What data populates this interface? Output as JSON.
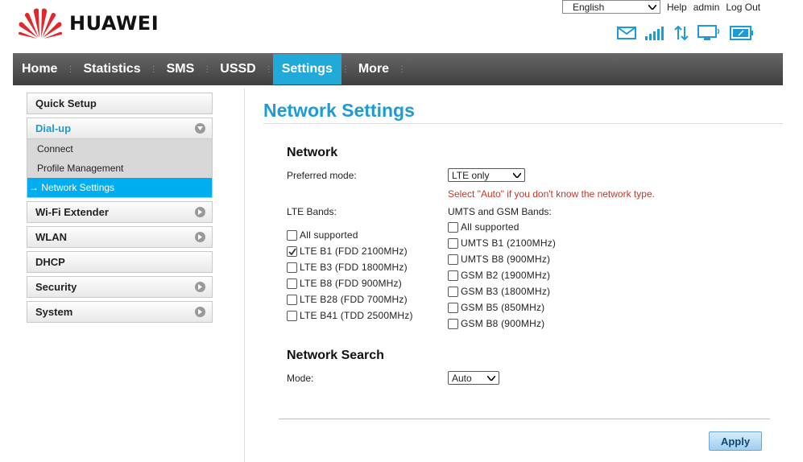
{
  "brand": {
    "name": "HUAWEI"
  },
  "top": {
    "language": "English",
    "help": "Help",
    "user": "admin",
    "logout": "Log Out"
  },
  "status_icons": [
    "mail-icon",
    "signal-strength-icon",
    "data-transfer-icon",
    "pc-connected-icon",
    "battery-icon"
  ],
  "nav": [
    {
      "label": "Home",
      "active": false
    },
    {
      "label": "Statistics",
      "active": false
    },
    {
      "label": "SMS",
      "active": false
    },
    {
      "label": "USSD",
      "active": false
    },
    {
      "label": "Settings",
      "active": true
    },
    {
      "label": "More",
      "active": false
    }
  ],
  "sidebar": {
    "quick_setup": "Quick Setup",
    "dialup": "Dial-up",
    "dialup_sub": [
      "Connect",
      "Profile Management",
      "→ Network Settings"
    ],
    "wifi_extender": "Wi-Fi Extender",
    "wlan": "WLAN",
    "dhcp": "DHCP",
    "security": "Security",
    "system": "System"
  },
  "page": {
    "title": "Network Settings"
  },
  "network": {
    "heading": "Network",
    "preferred_label": "Preferred mode:",
    "preferred_value": "LTE only",
    "hint": "Select \"Auto\" if you don't know the network type.",
    "lte_label": "LTE Bands:",
    "umts_label": "UMTS and GSM Bands:",
    "lte_bands": [
      {
        "label": "All supported",
        "checked": false
      },
      {
        "label": "LTE B1 (FDD 2100MHz)",
        "checked": true
      },
      {
        "label": "LTE B3 (FDD 1800MHz)",
        "checked": false
      },
      {
        "label": "LTE B8 (FDD 900MHz)",
        "checked": false
      },
      {
        "label": "LTE B28 (FDD 700MHz)",
        "checked": false
      },
      {
        "label": "LTE B41 (TDD 2500MHz)",
        "checked": false
      }
    ],
    "umts_bands": [
      {
        "label": "All supported",
        "checked": false
      },
      {
        "label": "UMTS B1 (2100MHz)",
        "checked": false
      },
      {
        "label": "UMTS B8 (900MHz)",
        "checked": false
      },
      {
        "label": "GSM B2 (1900MHz)",
        "checked": false
      },
      {
        "label": "GSM B3 (1800MHz)",
        "checked": false
      },
      {
        "label": "GSM B5 (850MHz)",
        "checked": false
      },
      {
        "label": "GSM B8 (900MHz)",
        "checked": false
      }
    ]
  },
  "search": {
    "heading": "Network Search",
    "mode_label": "Mode:",
    "mode_value": "Auto"
  },
  "apply_label": "Apply",
  "colors": {
    "accent": "#1c9bd6",
    "nav_active": "#21a9d8",
    "hint": "#c0392b"
  }
}
